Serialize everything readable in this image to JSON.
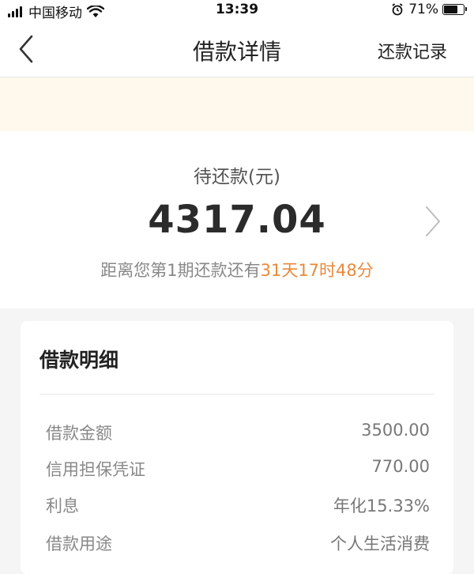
{
  "status_bar": {
    "carrier": "中国移动",
    "time": "13:39",
    "battery_text": "71%",
    "battery_level": 0.71
  },
  "nav": {
    "title": "借款详情",
    "right_action": "还款记录"
  },
  "amount": {
    "label": "待还款(元)",
    "value": "4317.04",
    "countdown_prefix": "距离您第1期还款还有",
    "countdown_value": "31天17时48分"
  },
  "details": {
    "title": "借款明细",
    "rows": [
      {
        "key": "借款金额",
        "value": "3500.00"
      },
      {
        "key": "信用担保凭证",
        "value": "770.00"
      },
      {
        "key": "利息",
        "value": "年化15.33%"
      },
      {
        "key": "借款用途",
        "value": "个人生活消费"
      }
    ]
  },
  "colors": {
    "accent": "#e88a3c",
    "notice_bg": "#fef9ec"
  }
}
